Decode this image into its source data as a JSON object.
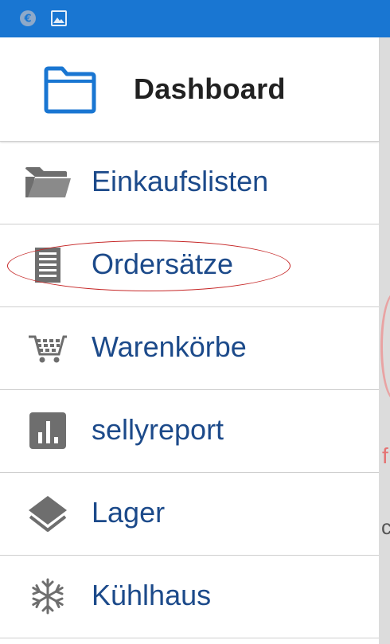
{
  "status_bar": {
    "icons": [
      "euro-icon",
      "image-icon"
    ],
    "color": "#1976d2"
  },
  "drawer": {
    "header": {
      "icon": "folder-icon",
      "title": "Dashboard"
    },
    "items": [
      {
        "label": "Einkaufslisten",
        "icon": "open-folder-icon"
      },
      {
        "label": "Ordersätze",
        "icon": "document-icon",
        "highlighted": true
      },
      {
        "label": "Warenkörbe",
        "icon": "shopping-cart-icon"
      },
      {
        "label": "sellyreport",
        "icon": "bar-chart-icon"
      },
      {
        "label": "Lager",
        "icon": "layers-icon"
      },
      {
        "label": "Kühlhaus",
        "icon": "snowflake-icon"
      }
    ]
  },
  "colors": {
    "accent": "#1976d2",
    "label": "#1c4a8a",
    "icon": "#6e6e6e",
    "highlight": "#c62828"
  }
}
